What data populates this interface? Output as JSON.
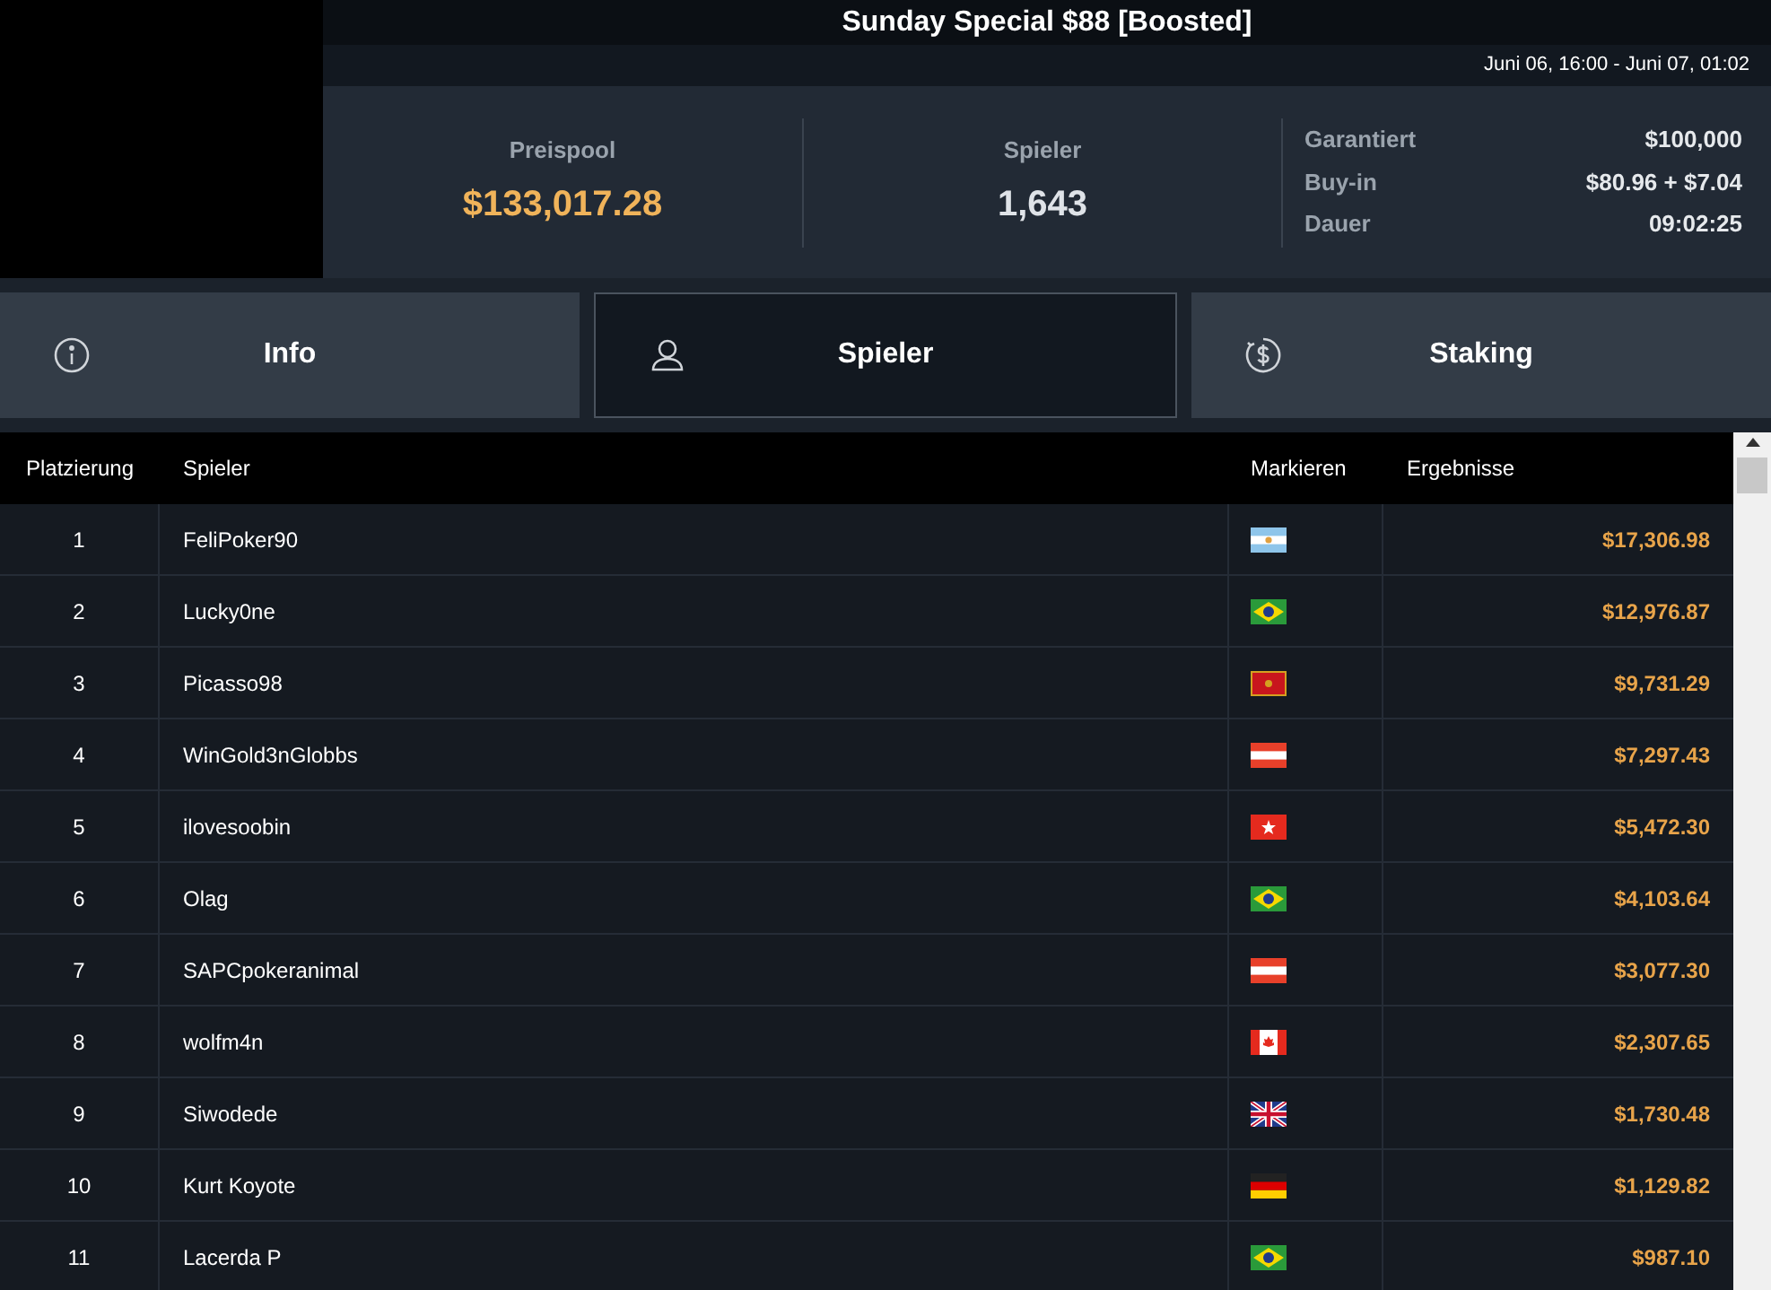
{
  "title": "Sunday Special $88 [Boosted]",
  "date_range": "Juni 06, 16:00 - Juni 07, 01:02",
  "stats": [
    {
      "label": "Preispool",
      "value": "$133,017.28",
      "highlight": true
    },
    {
      "label": "Spieler",
      "value": "1,643",
      "highlight": false
    }
  ],
  "details": [
    {
      "label": "Garantiert",
      "value": "$100,000"
    },
    {
      "label": "Buy-in",
      "value": "$80.96 + $7.04"
    },
    {
      "label": "Dauer",
      "value": "09:02:25"
    }
  ],
  "tabs": [
    {
      "label": "Info",
      "kind": "info",
      "selected": false
    },
    {
      "label": "Spieler",
      "kind": "person",
      "selected": true
    },
    {
      "label": "Staking",
      "kind": "dollar",
      "selected": false
    }
  ],
  "table": {
    "columns": [
      "Platzierung",
      "Spieler",
      "Markieren",
      "Ergebnisse"
    ],
    "rows": [
      {
        "place": "1",
        "player": "FeliPoker90",
        "kind": "argentina",
        "result": "$17,306.98"
      },
      {
        "place": "2",
        "player": "Lucky0ne",
        "kind": "brazil",
        "result": "$12,976.87"
      },
      {
        "place": "3",
        "player": "Picasso98",
        "kind": "montenegro",
        "result": "$9,731.29"
      },
      {
        "place": "4",
        "player": "WinGold3nGlobbs",
        "kind": "austria",
        "result": "$7,297.43"
      },
      {
        "place": "5",
        "player": "ilovesoobin",
        "kind": "hongkong",
        "result": "$5,472.30"
      },
      {
        "place": "6",
        "player": "Olag",
        "kind": "brazil",
        "result": "$4,103.64"
      },
      {
        "place": "7",
        "player": "SAPCpokeranimal",
        "kind": "austria",
        "result": "$3,077.30"
      },
      {
        "place": "8",
        "player": "wolfm4n",
        "kind": "canada",
        "result": "$2,307.65"
      },
      {
        "place": "9",
        "player": "Siwodede",
        "kind": "britain",
        "result": "$1,730.48"
      },
      {
        "place": "10",
        "player": "Kurt Koyote",
        "kind": "germany",
        "result": "$1,129.82"
      },
      {
        "place": "11",
        "player": "Lacerda P",
        "kind": "brazil",
        "result": "$987.10"
      }
    ]
  }
}
